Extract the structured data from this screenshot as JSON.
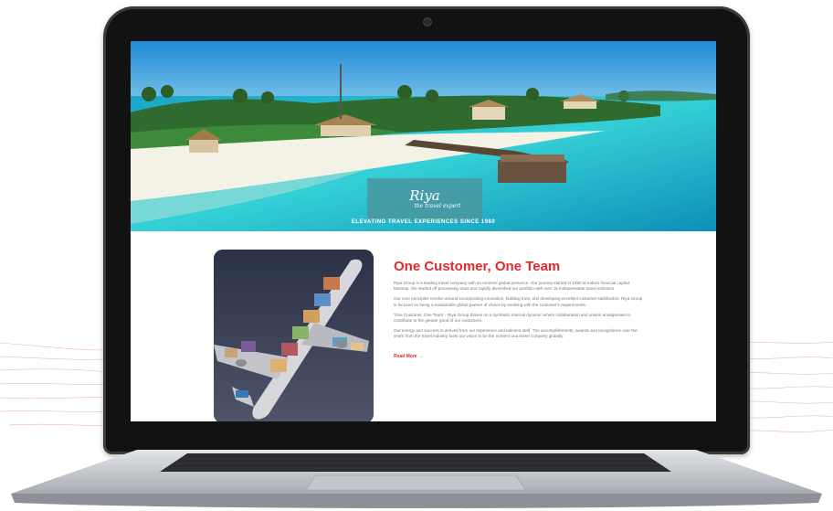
{
  "hero": {
    "logo_name": "Riya",
    "logo_tagline": "the travel expert",
    "tagline": "ELEVATING TRAVEL EXPERIENCES SINCE 1980"
  },
  "about": {
    "heading": "One Customer, One Team",
    "paragraphs": [
      "Riya Group is a leading travel company with an eminent global presence. Our journey started in 1980 at India's financial capital, Mumbai. We started off processing visas and rapidly diversified our portfolio with over 15 indispensable travel solutions.",
      "Our core principles revolve around incorporating innovation, building trust, and developing excellent customer satisfaction. Riya Group is focused on being a sustainable global partner of choice by evolving with the customer's requirements.",
      "'One Customer, One Team' - Riya Group thrives on a symbiotic internal dynamic where collaboration and unison amalgamate to contribute to the greater good of our customers.",
      "Our energy and success is derived from our experience and talented staff. The accomplishments, awards and recognitions over the years from the travel industry fuels our vision to be the numero una travel company globally."
    ],
    "read_more": "Read More →"
  },
  "colors": {
    "accent": "#e4282d",
    "laptop_bezel": "#121212",
    "laptop_body": "#c9ccd0",
    "sea": "#2ec4d4"
  },
  "icons": {
    "arrow": "arrow-right-icon",
    "camera": "webcam-icon"
  }
}
